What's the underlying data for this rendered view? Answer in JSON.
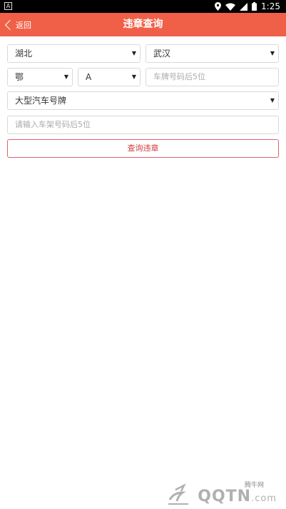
{
  "status_bar": {
    "time": "1:25",
    "notification_icon": "a-icon",
    "icons": [
      "location-icon",
      "wifi-icon",
      "signal-icon",
      "battery-icon"
    ]
  },
  "header": {
    "back_label": "返回",
    "title": "违章查询",
    "color": "#f06048"
  },
  "form": {
    "province": {
      "value": "湖北"
    },
    "city": {
      "value": "武汉"
    },
    "plate_prefix": {
      "value": "鄂"
    },
    "plate_letter": {
      "value": "A"
    },
    "plate_number": {
      "placeholder": "车牌号码后5位",
      "value": ""
    },
    "vehicle_type": {
      "value": "大型汽车号牌"
    },
    "frame_number": {
      "placeholder": "请输入车架号码后5位",
      "value": ""
    },
    "submit_label": "查询违章"
  },
  "watermark": {
    "small_text": "腾牛网",
    "brand": "QQTN",
    "suffix": ".com"
  }
}
